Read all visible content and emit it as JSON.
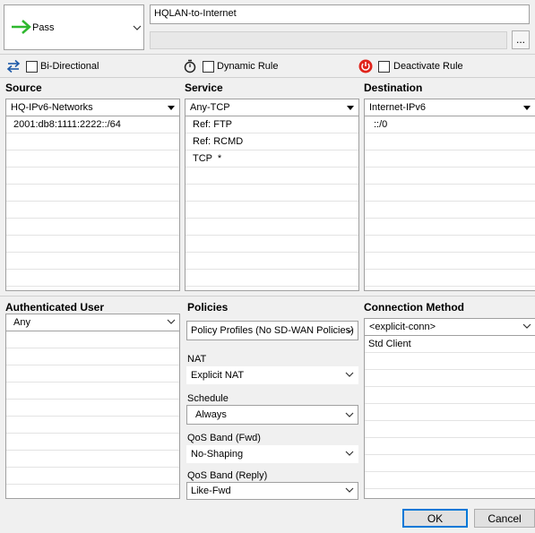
{
  "action": {
    "label": "Pass"
  },
  "rule": {
    "name": "HQLAN-to-Internet",
    "description": ""
  },
  "more_button": "...",
  "options": {
    "bidirectional": "Bi-Directional",
    "dynamic_rule": "Dynamic Rule",
    "deactivate_rule": "Deactivate Rule"
  },
  "source": {
    "header": "Source",
    "selected": "HQ-IPv6-Networks",
    "items": [
      "2001:db8:1111:2222::/64"
    ]
  },
  "service": {
    "header": "Service",
    "selected": "Any-TCP",
    "items": [
      "Ref: FTP",
      "Ref: RCMD",
      "TCP  *"
    ]
  },
  "destination": {
    "header": "Destination",
    "selected": "Internet-IPv6",
    "items": [
      "::/0"
    ]
  },
  "auth_user": {
    "header": "Authenticated User",
    "selected": "Any"
  },
  "policies": {
    "header": "Policies",
    "profile": "Policy Profiles (No SD-WAN Policies)",
    "nat_label": "NAT",
    "nat_value": "Explicit NAT",
    "schedule_label": "Schedule",
    "schedule_value": "Always",
    "qos_fwd_label": "QoS Band (Fwd)",
    "qos_fwd_value": "No-Shaping",
    "qos_reply_label": "QoS Band (Reply)",
    "qos_reply_value": "Like-Fwd"
  },
  "connection": {
    "header": "Connection Method",
    "selected": "<explicit-conn>",
    "items": [
      "Std Client"
    ]
  },
  "buttons": {
    "ok": "OK",
    "cancel": "Cancel"
  },
  "colors": {
    "pass_arrow": "#2eb82e",
    "bidir_arrow": "#1e5aa8",
    "deactivate": "#e0241b"
  }
}
